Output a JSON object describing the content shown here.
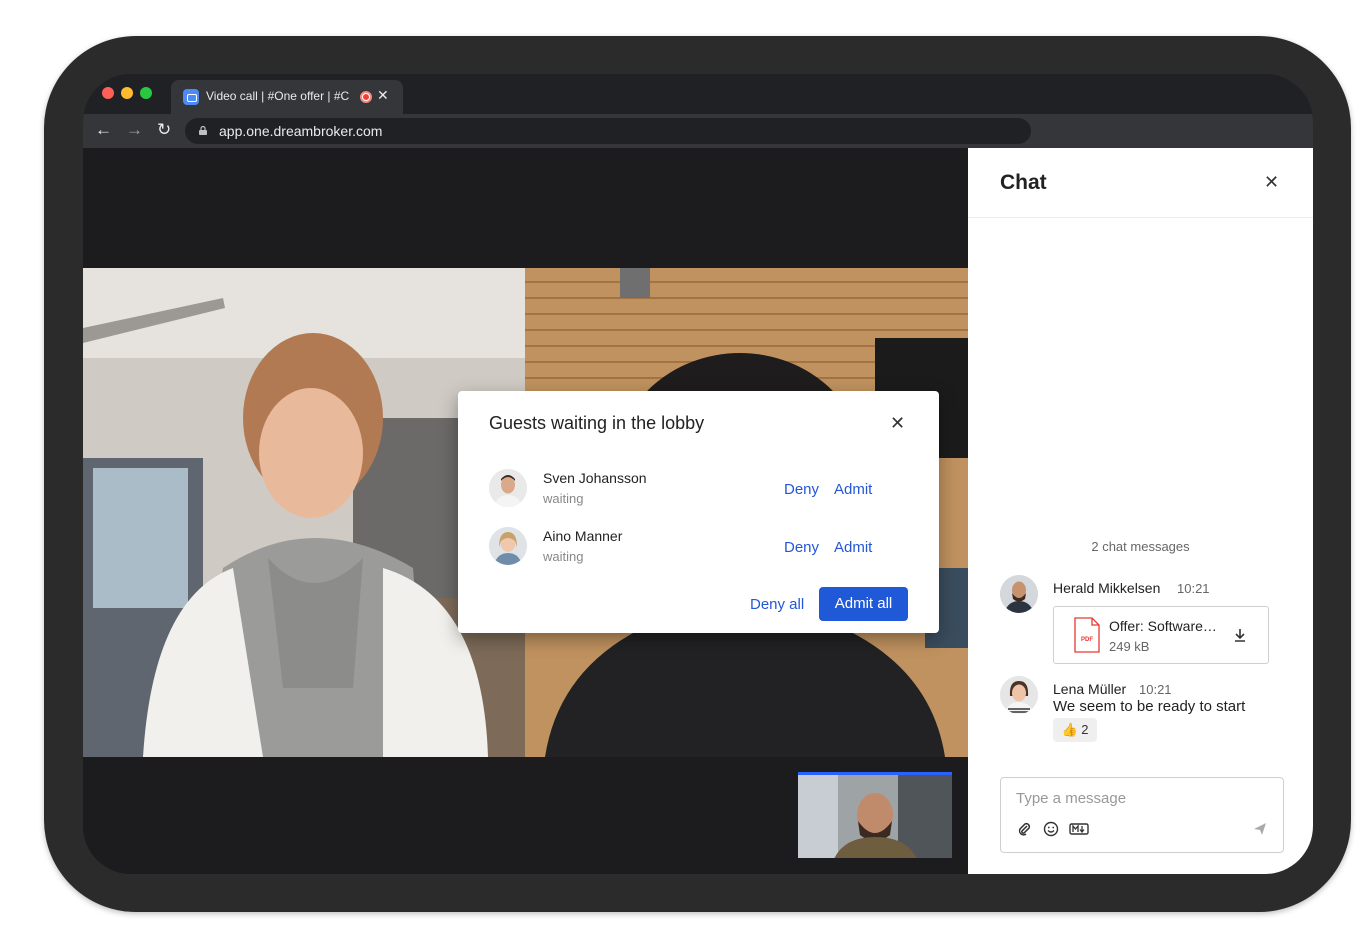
{
  "browser": {
    "tab_title": "Video call | #One offer  | #C",
    "url": "app.one.dreambroker.com",
    "traffic_colors": [
      "#ff5f57",
      "#febc2e",
      "#28c840"
    ]
  },
  "lobby": {
    "title": "Guests waiting in the lobby",
    "guests": [
      {
        "name": "Sven Johansson",
        "status": "waiting",
        "deny_label": "Deny",
        "admit_label": "Admit"
      },
      {
        "name": "Aino Manner",
        "status": "waiting",
        "deny_label": "Deny",
        "admit_label": "Admit"
      }
    ],
    "deny_all_label": "Deny all",
    "admit_all_label": "Admit all"
  },
  "chat": {
    "title": "Chat",
    "message_count": "2 chat messages",
    "messages": [
      {
        "author": "Herald Mikkelsen",
        "time": "10:21",
        "file": {
          "name": "Offer: Software…",
          "size": "249 kB",
          "type_label": "PDF"
        }
      },
      {
        "author": "Lena Müller",
        "time": "10:21",
        "text": "We seem to be ready to start",
        "reaction": "👍 2"
      }
    ],
    "composer_placeholder": "Type a message",
    "composer_icons": [
      "attachment-icon",
      "emoji-icon",
      "markdown-icon",
      "send-icon"
    ]
  },
  "accent_color": "#2059d8"
}
